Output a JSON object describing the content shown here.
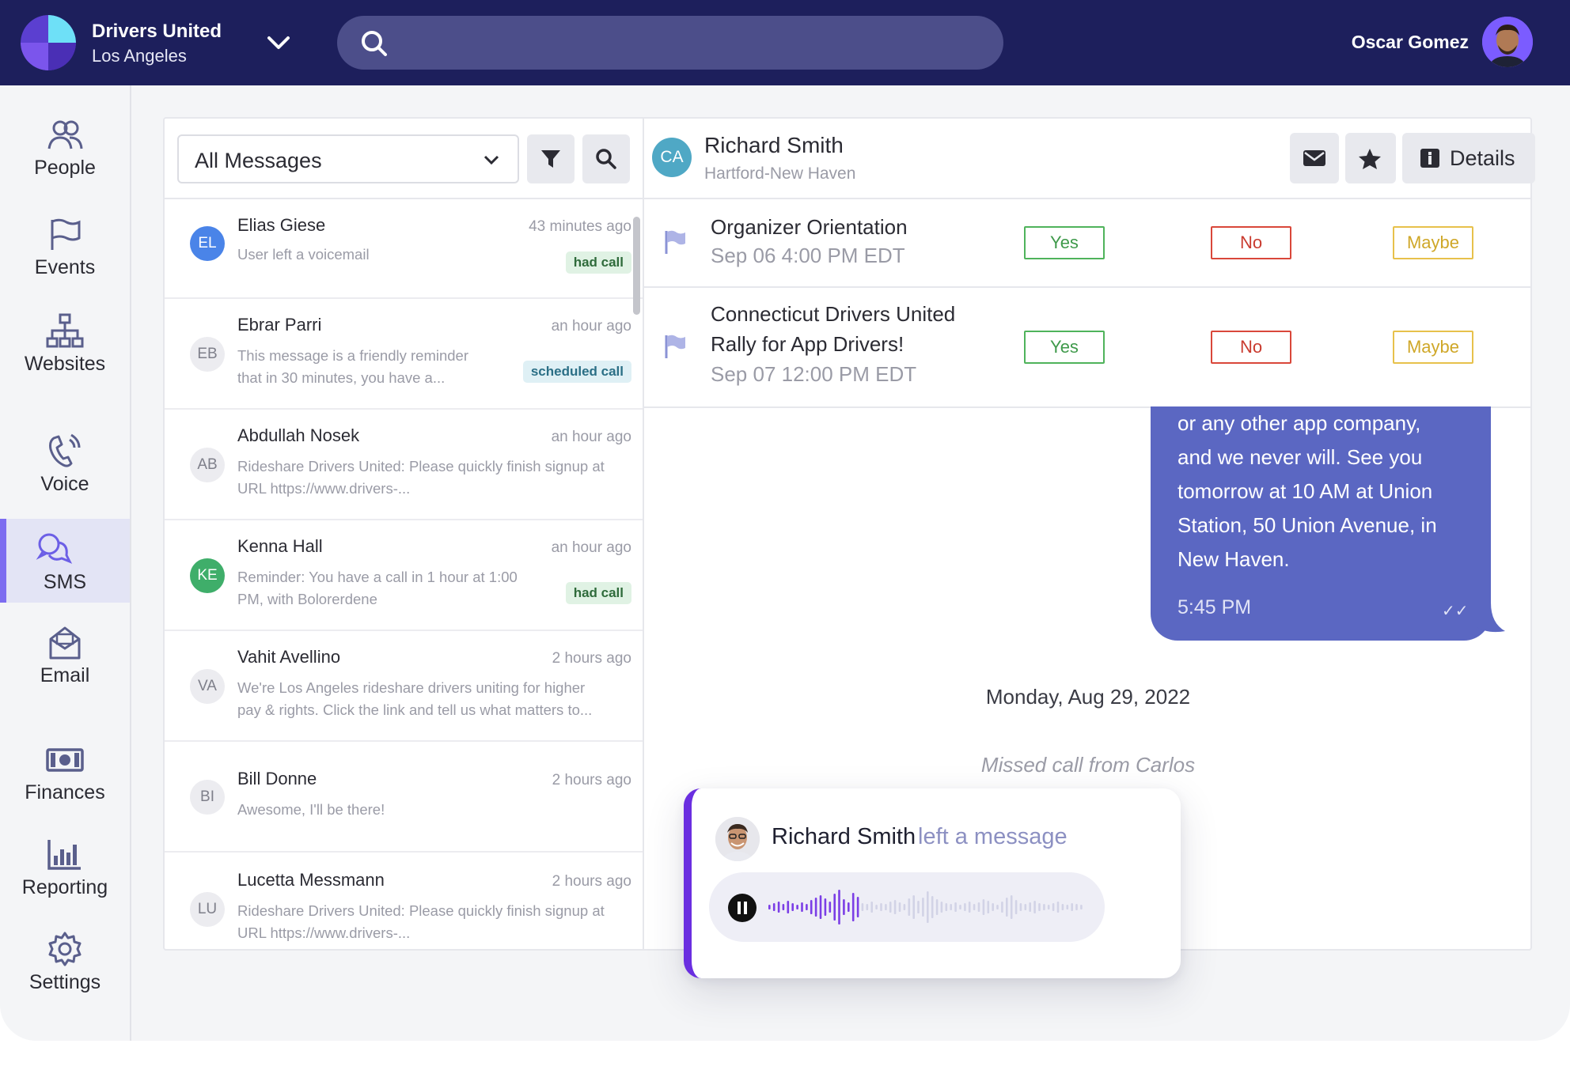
{
  "org": {
    "name": "Drivers United",
    "city": "Los Angeles"
  },
  "user": {
    "name": "Oscar Gomez"
  },
  "nav": [
    {
      "label": "People",
      "icon": "people-icon"
    },
    {
      "label": "Events",
      "icon": "flag-icon"
    },
    {
      "label": "Websites",
      "icon": "sitemap-icon"
    },
    {
      "label": "Voice",
      "icon": "phone-icon"
    },
    {
      "label": "SMS",
      "icon": "chat-icon",
      "active": true
    },
    {
      "label": "Email",
      "icon": "mail-open-icon"
    },
    {
      "label": "Finances",
      "icon": "money-icon"
    },
    {
      "label": "Reporting",
      "icon": "bar-chart-icon"
    },
    {
      "label": "Settings",
      "icon": "gear-icon"
    }
  ],
  "list": {
    "filter_selected": "All Messages",
    "conversations": [
      {
        "initials": "EL",
        "name": "Elias Giese",
        "time": "43 minutes ago",
        "preview": "User left a voicemail",
        "preview2": "",
        "tag": "had call"
      },
      {
        "initials": "EB",
        "name": "Ebrar Parri",
        "time": "an hour ago",
        "preview": "This message is a friendly reminder",
        "preview2": "that in 30 minutes, you have a...",
        "tag": "scheduled call"
      },
      {
        "initials": "AB",
        "name": "Abdullah Nosek",
        "time": "an hour ago",
        "preview": "Rideshare Drivers United: Please quickly finish signup at",
        "preview2": "URL https://www.drivers-...",
        "tag": ""
      },
      {
        "initials": "KE",
        "name": "Kenna Hall",
        "time": "an hour ago",
        "preview": "Reminder: You have a call in 1 hour at 1:00",
        "preview2": "PM, with Bolorerdene",
        "tag": "had call"
      },
      {
        "initials": "VA",
        "name": "Vahit Avellino",
        "time": "2 hours ago",
        "preview": "We're Los Angeles rideshare drivers uniting for higher",
        "preview2": "pay & rights. Click the link and tell us what matters to...",
        "tag": ""
      },
      {
        "initials": "BI",
        "name": "Bill Donne",
        "time": "2 hours ago",
        "preview": "Awesome, I'll be there!",
        "preview2": "",
        "tag": ""
      },
      {
        "initials": "LU",
        "name": "Lucetta Messmann",
        "time": "2 hours ago",
        "preview": "Rideshare Drivers United: Please quickly finish signup at",
        "preview2": "URL https://www.drivers-...",
        "tag": ""
      }
    ]
  },
  "chat": {
    "initials": "CA",
    "name": "Richard Smith",
    "location": "Hartford-New Haven",
    "details_label": "Details",
    "events": [
      {
        "title": "Organizer Orientation",
        "title2": "",
        "date": "Sep 06 4:00 PM EDT"
      },
      {
        "title": "Connecticut Drivers United",
        "title2": "Rally for App Drivers!",
        "date": "Sep 07 12:00 PM EDT"
      }
    ],
    "rsvp": {
      "yes": "Yes",
      "no": "No",
      "maybe": "Maybe"
    },
    "bubble": {
      "lines": [
        "or any other app company,",
        "and we never will.    See you",
        "tomorrow at 10 AM at Union",
        "Station, 50 Union Avenue, in",
        "New Haven."
      ],
      "time": "5:45 PM",
      "status": "✓✓"
    },
    "date_separator": "Monday, Aug 29, 2022",
    "missed_call": "Missed call from Carlos"
  },
  "voicemail": {
    "name": "Richard Smith",
    "action": "left a message",
    "played_fraction": 0.29
  },
  "colors": {
    "topbar": "#1d1f5c",
    "accent": "#7c6cf0",
    "bubble": "#5b67c2",
    "wave_played": "#7b3ee6",
    "wave_unplayed": "#d2d3e6"
  }
}
